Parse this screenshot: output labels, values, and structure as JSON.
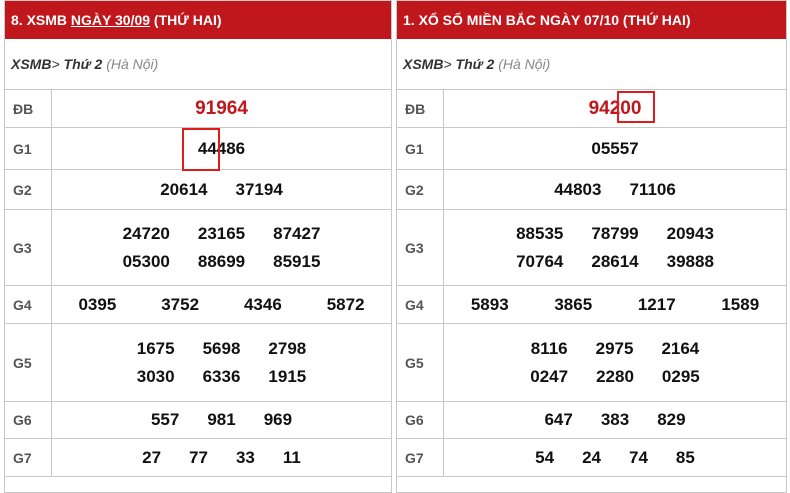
{
  "left": {
    "header": {
      "prefix": "8. XSMB ",
      "date_label": "NGÀY 30/09",
      "suffix": " (THỨ HAI)"
    },
    "breadcrumb": {
      "root": "XSMB",
      "sep": "> ",
      "day": "Thứ 2 ",
      "region": "(Hà Nội)"
    },
    "rows": [
      {
        "label": "ĐB",
        "lines": [
          [
            "91964"
          ]
        ]
      },
      {
        "label": "G1",
        "lines": [
          [
            "44486"
          ]
        ]
      },
      {
        "label": "G2",
        "lines": [
          [
            "20614",
            "37194"
          ]
        ]
      },
      {
        "label": "G3",
        "lines": [
          [
            "24720",
            "23165",
            "87427"
          ],
          [
            "05300",
            "88699",
            "85915"
          ]
        ]
      },
      {
        "label": "G4",
        "lines": [
          [
            "0395",
            "3752",
            "4346",
            "5872"
          ]
        ]
      },
      {
        "label": "G5",
        "lines": [
          [
            "1675",
            "5698",
            "2798"
          ],
          [
            "3030",
            "6336",
            "1915"
          ]
        ]
      },
      {
        "label": "G6",
        "lines": [
          [
            "557",
            "981",
            "969"
          ]
        ]
      },
      {
        "label": "G7",
        "lines": [
          [
            "27",
            "77",
            "33",
            "11"
          ]
        ]
      }
    ]
  },
  "right": {
    "header": {
      "prefix": "1. XỔ SỐ MIỀN BẮC NGÀY 07/10 (THỨ HAI)",
      "date_label": "",
      "suffix": ""
    },
    "breadcrumb": {
      "root": "XSMB",
      "sep": "> ",
      "day": "Thứ 2 ",
      "region": "(Hà Nội)"
    },
    "rows": [
      {
        "label": "ĐB",
        "lines": [
          [
            "94200"
          ]
        ]
      },
      {
        "label": "G1",
        "lines": [
          [
            "05557"
          ]
        ]
      },
      {
        "label": "G2",
        "lines": [
          [
            "44803",
            "71106"
          ]
        ]
      },
      {
        "label": "G3",
        "lines": [
          [
            "88535",
            "78799",
            "20943"
          ],
          [
            "70764",
            "28614",
            "39888"
          ]
        ]
      },
      {
        "label": "G4",
        "lines": [
          [
            "5893",
            "3865",
            "1217",
            "1589"
          ]
        ]
      },
      {
        "label": "G5",
        "lines": [
          [
            "8116",
            "2975",
            "2164"
          ],
          [
            "0247",
            "2280",
            "0295"
          ]
        ]
      },
      {
        "label": "G6",
        "lines": [
          [
            "647",
            "383",
            "829"
          ]
        ]
      },
      {
        "label": "G7",
        "lines": [
          [
            "54",
            "24",
            "74",
            "85"
          ]
        ]
      }
    ]
  },
  "highlight_color": "#e01b1b",
  "brand_color": "#c0171c"
}
